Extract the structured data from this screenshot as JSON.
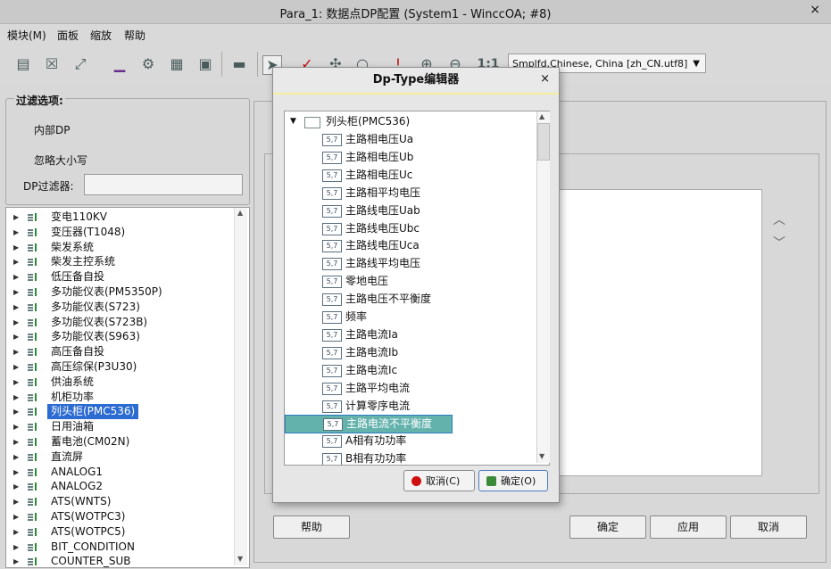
{
  "window": {
    "title": "Para_1: 数据点DP配置 (System1 - WinccOA; #8)",
    "close_symbol": "×"
  },
  "menu": {
    "items": [
      "模块(M)",
      "面板",
      "缩放",
      "帮助"
    ]
  },
  "toolbar": {
    "icons": [
      "panel-new-icon",
      "close-panel-icon",
      "expand-icon",
      "underline-icon",
      "gear-icon",
      "grid-icon",
      "table-icon",
      "print-icon",
      "pointer-icon",
      "check-icon",
      "move-icon",
      "search-icon",
      "alarm-icon",
      "zoom-in-icon",
      "zoom-out-icon"
    ],
    "zoom_reset_label": "1:1",
    "language_value": "Smplfd.Chinese, China [zh_CN.utf8]"
  },
  "filter": {
    "title": "过滤选项:",
    "internal_dp": "内部DP",
    "ignore_case": "忽略大小写",
    "dp_filter_label": "DP过滤器:",
    "dp_filter_value": ""
  },
  "dp_tree": {
    "items": [
      {
        "label": "变电110KV",
        "selected": false
      },
      {
        "label": "变压器(T1048)",
        "selected": false
      },
      {
        "label": "柴发系统",
        "selected": false
      },
      {
        "label": "柴发主控系统",
        "selected": false
      },
      {
        "label": "低压备自投",
        "selected": false
      },
      {
        "label": "多功能仪表(PM5350P)",
        "selected": false
      },
      {
        "label": "多功能仪表(S723)",
        "selected": false
      },
      {
        "label": "多功能仪表(S723B)",
        "selected": false
      },
      {
        "label": "多功能仪表(S963)",
        "selected": false
      },
      {
        "label": "高压备自投",
        "selected": false
      },
      {
        "label": "高压综保(P3U30)",
        "selected": false
      },
      {
        "label": "供油系统",
        "selected": false
      },
      {
        "label": "机柜功率",
        "selected": false
      },
      {
        "label": "列头柜(PMC536)",
        "selected": true
      },
      {
        "label": "日用油箱",
        "selected": false
      },
      {
        "label": "蓄电池(CM02N)",
        "selected": false
      },
      {
        "label": "直流屏",
        "selected": false
      },
      {
        "label": "ANALOG1",
        "selected": false
      },
      {
        "label": "ANALOG2",
        "selected": false
      },
      {
        "label": "ATS(WNTS)",
        "selected": false
      },
      {
        "label": "ATS(WOTPC3)",
        "selected": false
      },
      {
        "label": "ATS(WOTPC5)",
        "selected": false
      },
      {
        "label": "BIT_CONDITION",
        "selected": false
      },
      {
        "label": "COUNTER_SUB",
        "selected": false
      }
    ]
  },
  "main_buttons": {
    "help": "帮助",
    "ok": "确定",
    "apply": "应用",
    "cancel": "取消"
  },
  "dialog": {
    "title": "Dp-Type编辑器",
    "close_symbol": "×",
    "root_label": "列头柜(PMC536)",
    "type_badge": "5,7",
    "elements": [
      {
        "label": "主路相电压Ua",
        "selected": false
      },
      {
        "label": "主路相电压Ub",
        "selected": false
      },
      {
        "label": "主路相电压Uc",
        "selected": false
      },
      {
        "label": "主路相平均电压",
        "selected": false
      },
      {
        "label": "主路线电压Uab",
        "selected": false
      },
      {
        "label": "主路线电压Ubc",
        "selected": false
      },
      {
        "label": "主路线电压Uca",
        "selected": false
      },
      {
        "label": "主路线平均电压",
        "selected": false
      },
      {
        "label": "零地电压",
        "selected": false
      },
      {
        "label": "主路电压不平衡度",
        "selected": false
      },
      {
        "label": "频率",
        "selected": false
      },
      {
        "label": "主路电流Ia",
        "selected": false
      },
      {
        "label": "主路电流Ib",
        "selected": false
      },
      {
        "label": "主路电流Ic",
        "selected": false
      },
      {
        "label": "主路平均电流",
        "selected": false
      },
      {
        "label": "计算零序电流",
        "selected": false
      },
      {
        "label": "主路电流不平衡度",
        "selected": true
      },
      {
        "label": "A相有功功率",
        "selected": false
      },
      {
        "label": "B相有功功率",
        "selected": false
      }
    ],
    "cancel_label": "取消(C)",
    "ok_label": "确定(O)",
    "colors": {
      "cancel_icon": "#d01010",
      "ok_icon": "#3a8a3a",
      "selection": "#64b2ac"
    }
  }
}
